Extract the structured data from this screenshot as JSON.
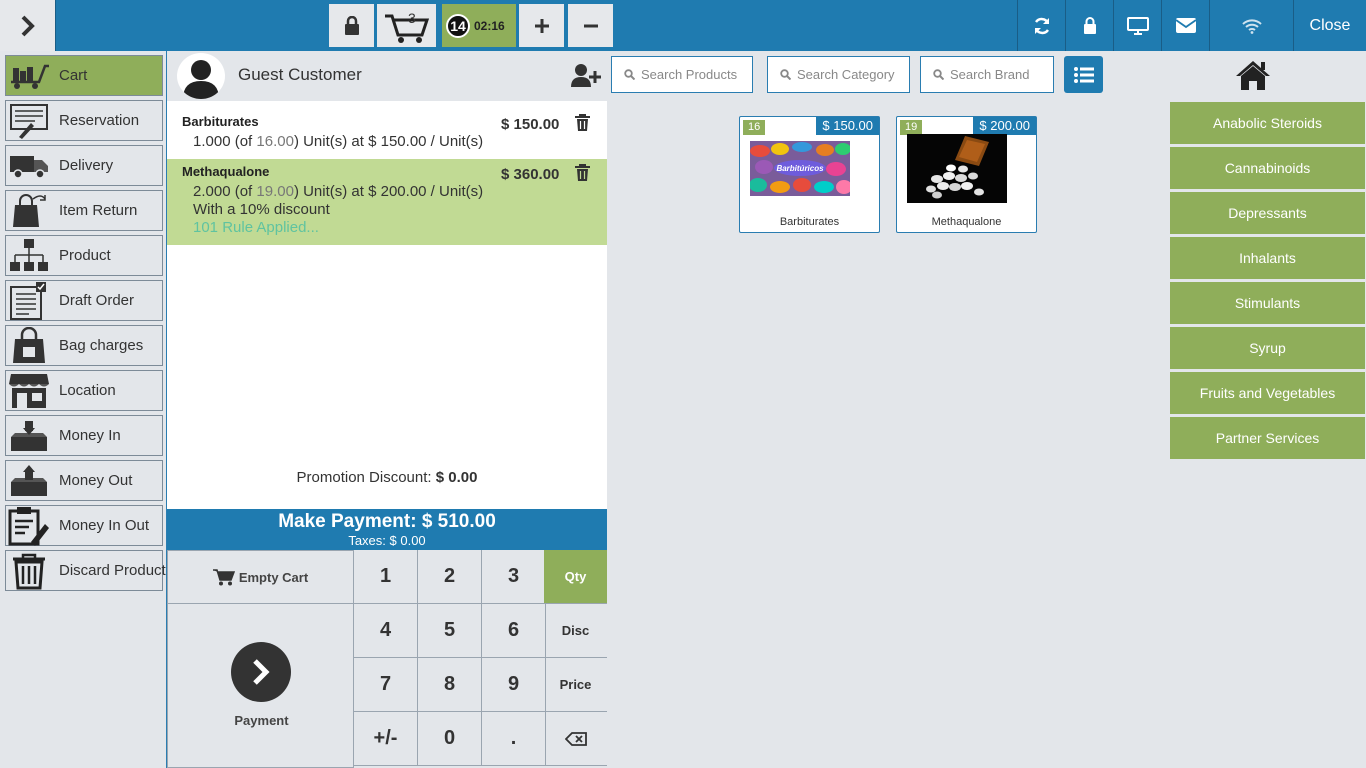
{
  "topbar": {
    "cart_count": "3",
    "session_number": "14",
    "session_time": "02:16",
    "close_label": "Close"
  },
  "sidebar": {
    "items": [
      {
        "label": "Cart",
        "icon": "cart-icon",
        "active": true
      },
      {
        "label": "Reservation",
        "icon": "reservation-icon"
      },
      {
        "label": "Delivery",
        "icon": "delivery-truck-icon"
      },
      {
        "label": "Item Return",
        "icon": "item-return-icon"
      },
      {
        "label": "Product",
        "icon": "product-hierarchy-icon"
      },
      {
        "label": "Draft Order",
        "icon": "draft-order-icon"
      },
      {
        "label": "Bag charges",
        "icon": "bag-icon"
      },
      {
        "label": "Location",
        "icon": "store-location-icon"
      },
      {
        "label": "Money In",
        "icon": "money-in-icon"
      },
      {
        "label": "Money Out",
        "icon": "money-out-icon"
      },
      {
        "label": "Money In Out",
        "icon": "money-in-out-icon"
      },
      {
        "label": "Discard Product",
        "icon": "trash-bin-icon"
      }
    ]
  },
  "order": {
    "customer_name": "Guest Customer",
    "lines": [
      {
        "name": "Barbiturates",
        "qty": "1.000",
        "of_prefix": " (of ",
        "stock": "16.00",
        "rest": ") Unit(s) at $ 150.00 / Unit(s)",
        "price": "$ 150.00"
      },
      {
        "name": "Methaqualone",
        "qty": "2.000",
        "of_prefix": " (of ",
        "stock": "19.00",
        "rest": ") Unit(s) at $ 200.00 / Unit(s)",
        "discount": "With a 10% discount",
        "rule": "101 Rule Applied...",
        "price": "$ 360.00"
      }
    ],
    "promo_label": "Promotion Discount:",
    "promo_value": "$ 0.00",
    "make_payment": "Make Payment: $ 510.00",
    "taxes": "Taxes: $ 0.00"
  },
  "numpad": {
    "empty_cart": "Empty Cart",
    "payment": "Payment",
    "keys": [
      "1",
      "2",
      "3",
      "4",
      "5",
      "6",
      "7",
      "8",
      "9",
      "+/-",
      "0",
      "."
    ],
    "modes": [
      "Qty",
      "Disc",
      "Price"
    ],
    "active_mode": "Qty"
  },
  "products": {
    "search_products": "Search Products",
    "search_category": "Search Category",
    "search_brand": "Search Brand",
    "cards": [
      {
        "name": "Barbiturates",
        "qty": "16",
        "price": "$ 150.00",
        "image_text": "Barbitúricos"
      },
      {
        "name": "Methaqualone",
        "qty": "19",
        "price": "$ 200.00"
      }
    ],
    "categories": [
      "Anabolic Steroids",
      "Cannabinoids",
      "Depressants",
      "Inhalants",
      "Stimulants",
      "Syrup",
      "Fruits and Vegetables",
      "Partner Services"
    ]
  },
  "colors": {
    "brand_blue": "#1f7bb0",
    "accent_green": "#8fae5a",
    "selected_line": "#c1da94"
  }
}
